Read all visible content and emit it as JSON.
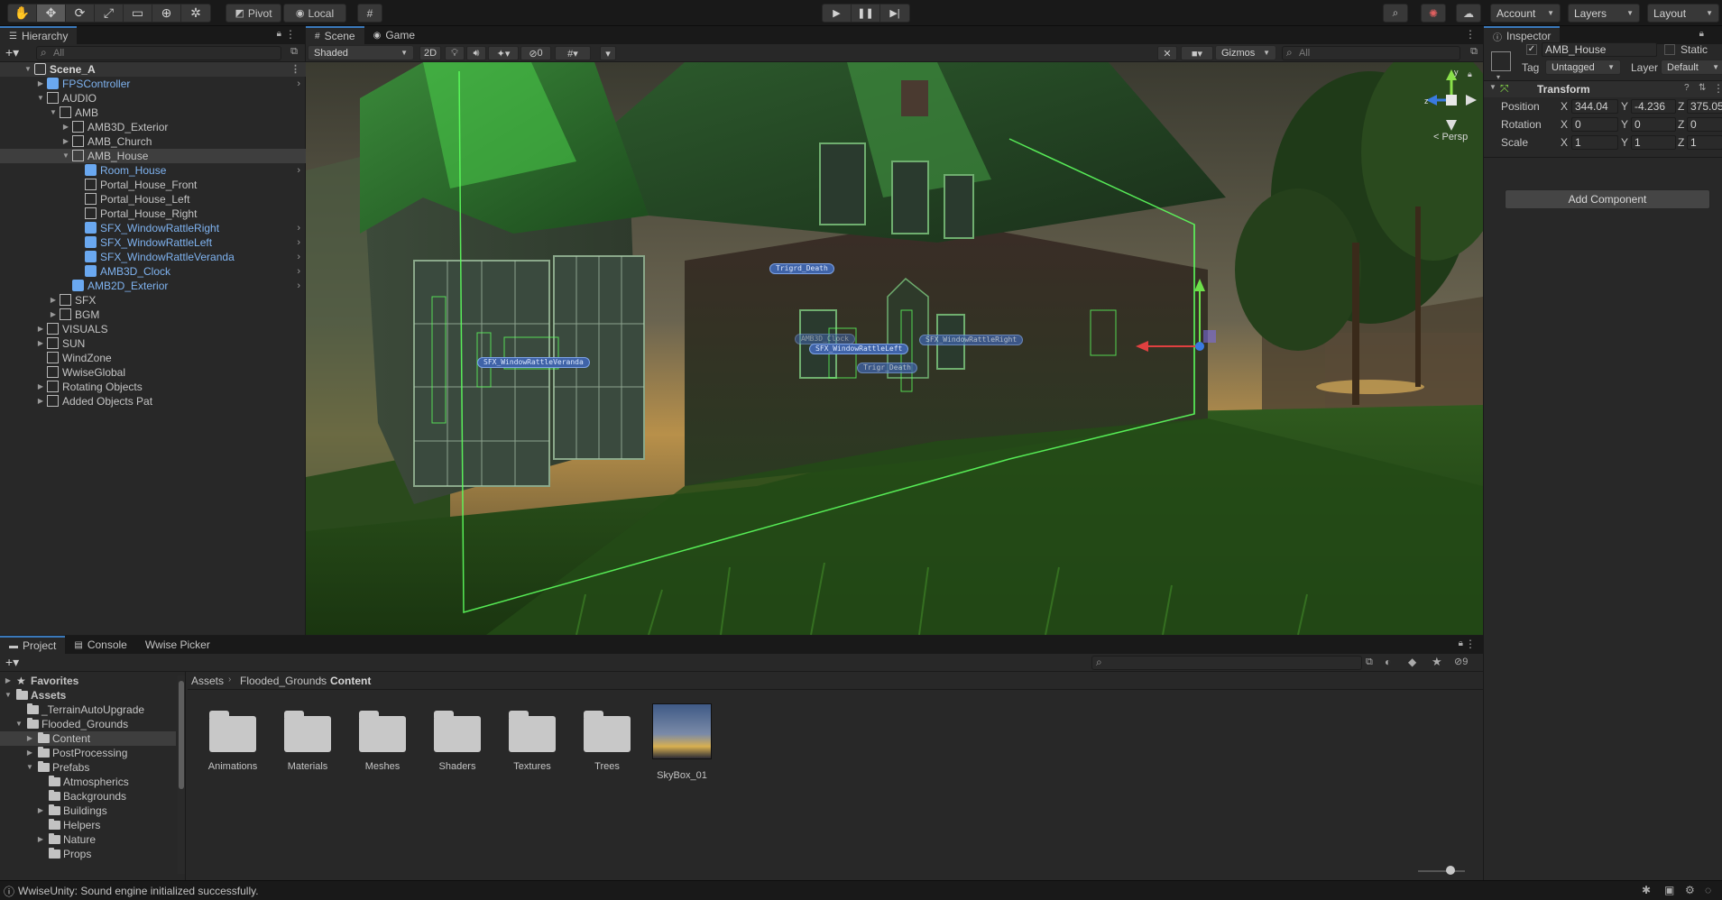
{
  "toolbar": {
    "pivot": "Pivot",
    "local": "Local",
    "account": "Account",
    "layers": "Layers",
    "layout": "Layout"
  },
  "hierarchy": {
    "tab": "Hierarchy",
    "search_placeholder": "All",
    "items": [
      {
        "label": "Scene_A",
        "type": "scene",
        "expanded": true
      },
      {
        "label": "FPSController",
        "type": "prefab",
        "arrow": "collapsed",
        "more": true
      },
      {
        "label": "AUDIO",
        "type": "go",
        "arrow": "expanded"
      },
      {
        "label": "AMB",
        "type": "go",
        "arrow": "expanded"
      },
      {
        "label": "AMB3D_Exterior",
        "type": "go",
        "arrow": "collapsed"
      },
      {
        "label": "AMB_Church",
        "type": "go",
        "arrow": "collapsed"
      },
      {
        "label": "AMB_House",
        "type": "go",
        "arrow": "expanded",
        "selected": true
      },
      {
        "label": "Room_House",
        "type": "prefab",
        "more": true
      },
      {
        "label": "Portal_House_Front",
        "type": "go"
      },
      {
        "label": "Portal_House_Left",
        "type": "go"
      },
      {
        "label": "Portal_House_Right",
        "type": "go"
      },
      {
        "label": "SFX_WindowRattleRight",
        "type": "prefab",
        "more": true
      },
      {
        "label": "SFX_WindowRattleLeft",
        "type": "prefab",
        "more": true
      },
      {
        "label": "SFX_WindowRattleVeranda",
        "type": "prefab",
        "more": true
      },
      {
        "label": "AMB3D_Clock",
        "type": "prefab",
        "more": true
      },
      {
        "label": "AMB2D_Exterior",
        "type": "prefab",
        "more": true
      },
      {
        "label": "SFX",
        "type": "go",
        "arrow": "collapsed"
      },
      {
        "label": "BGM",
        "type": "go",
        "arrow": "collapsed"
      },
      {
        "label": "VISUALS",
        "type": "go",
        "arrow": "collapsed"
      },
      {
        "label": "SUN",
        "type": "go",
        "arrow": "collapsed"
      },
      {
        "label": "WindZone",
        "type": "go"
      },
      {
        "label": "WwiseGlobal",
        "type": "go"
      },
      {
        "label": "Rotating Objects",
        "type": "go",
        "arrow": "collapsed"
      },
      {
        "label": "Added Objects Pat",
        "type": "go",
        "arrow": "collapsed"
      }
    ]
  },
  "scene": {
    "tabs": [
      "Scene",
      "Game"
    ],
    "shading": "Shaded",
    "mode_2d": "2D",
    "hidden_count": "0",
    "gizmos": "Gizmos",
    "search_placeholder": "All",
    "persp": "< Persp",
    "labels": [
      "SFX_WindowRattleVeranda",
      "Trigrd_Death",
      "SFX_WindowRattleLeft",
      "SFX_WindowRattleRight",
      "Trigr_Death",
      "AMB3D_Clock"
    ]
  },
  "inspector": {
    "tab": "Inspector",
    "object_name": "AMB_House",
    "static": "Static",
    "tag_label": "Tag",
    "tag_value": "Untagged",
    "layer_label": "Layer",
    "layer_value": "Default",
    "component": "Transform",
    "position_label": "Position",
    "rotation_label": "Rotation",
    "scale_label": "Scale",
    "position": {
      "x": "344.04",
      "y": "-4.236",
      "z": "375.05"
    },
    "rotation": {
      "x": "0",
      "y": "0",
      "z": "0"
    },
    "scale": {
      "x": "1",
      "y": "1",
      "z": "1"
    },
    "add_component": "Add Component"
  },
  "project": {
    "tabs": [
      "Project",
      "Console",
      "Wwise Picker"
    ],
    "hidden_count": "9",
    "breadcrumb": [
      "Assets",
      "Flooded_Grounds",
      "Content"
    ],
    "tree": [
      {
        "label": "Favorites",
        "bold": true,
        "arrow": "collapsed",
        "star": true
      },
      {
        "label": "Assets",
        "bold": true,
        "arrow": "expanded"
      },
      {
        "label": "_TerrainAutoUpgrade",
        "indent": 1
      },
      {
        "label": "Flooded_Grounds",
        "indent": 1,
        "arrow": "expanded"
      },
      {
        "label": "Content",
        "indent": 2,
        "arrow": "collapsed",
        "selected": true
      },
      {
        "label": "PostProcessing",
        "indent": 2,
        "arrow": "collapsed"
      },
      {
        "label": "Prefabs",
        "indent": 2,
        "arrow": "expanded"
      },
      {
        "label": "Atmospherics",
        "indent": 3
      },
      {
        "label": "Backgrounds",
        "indent": 3
      },
      {
        "label": "Buildings",
        "indent": 3,
        "arrow": "collapsed"
      },
      {
        "label": "Helpers",
        "indent": 3
      },
      {
        "label": "Nature",
        "indent": 3,
        "arrow": "collapsed"
      },
      {
        "label": "Props",
        "indent": 3
      }
    ],
    "assets": [
      {
        "label": "Animations",
        "kind": "folder"
      },
      {
        "label": "Materials",
        "kind": "folder"
      },
      {
        "label": "Meshes",
        "kind": "folder"
      },
      {
        "label": "Shaders",
        "kind": "folder"
      },
      {
        "label": "Textures",
        "kind": "folder"
      },
      {
        "label": "Trees",
        "kind": "folder"
      },
      {
        "label": "SkyBox_01",
        "kind": "skybox"
      }
    ]
  },
  "status": {
    "message": "WwiseUnity: Sound engine initialized successfully."
  },
  "colors": {
    "accent": "#3a79bb",
    "prefab_text": "#7fb3f0",
    "gizmo_label": "#3f63a8",
    "wireframe": "#5dff5d"
  }
}
